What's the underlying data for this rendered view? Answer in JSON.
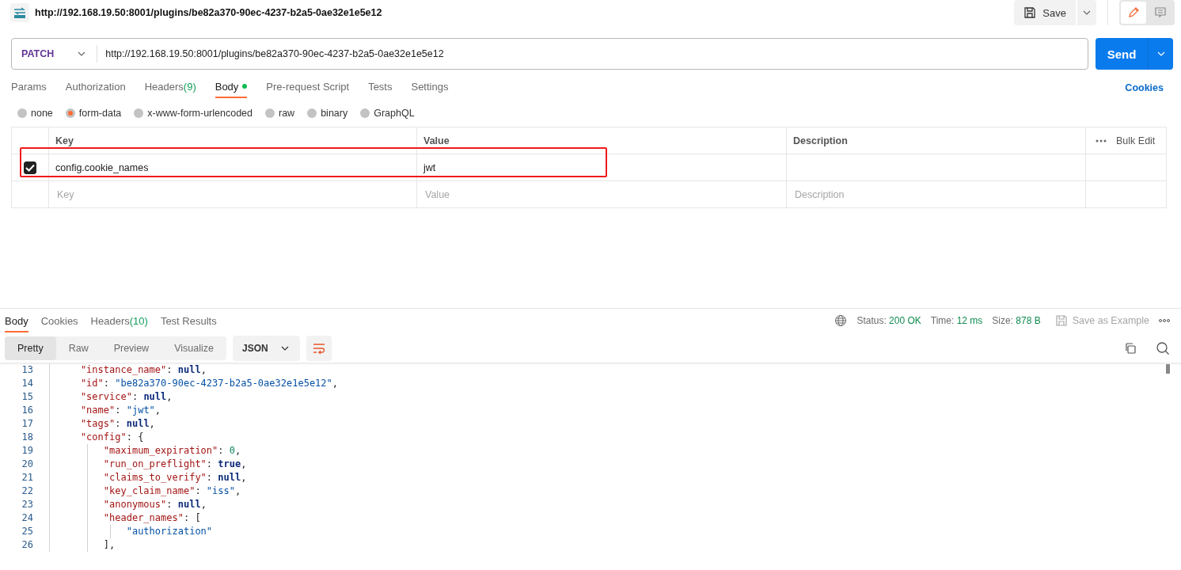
{
  "header": {
    "title": "http://192.168.19.50:8001/plugins/be82a370-90ec-4237-b2a5-0ae32e1e5e12",
    "save_label": "Save",
    "mode": [
      {
        "kind": "edit",
        "selected": true
      },
      {
        "kind": "comment",
        "selected": false
      }
    ]
  },
  "request": {
    "method": "PATCH",
    "url": "http://192.168.19.50:8001/plugins/be82a370-90ec-4237-b2a5-0ae32e1e5e12",
    "send_label": "Send"
  },
  "request_tabs": [
    {
      "label": "Params",
      "selected": false
    },
    {
      "label": "Authorization",
      "selected": false
    },
    {
      "label": "Headers",
      "count": "(9)",
      "selected": false
    },
    {
      "label": "Body",
      "dot": true,
      "selected": true
    },
    {
      "label": "Pre-request Script",
      "selected": false
    },
    {
      "label": "Tests",
      "selected": false
    },
    {
      "label": "Settings",
      "selected": false
    }
  ],
  "cookies_link": "Cookies",
  "body_types": [
    {
      "label": "none",
      "selected": false
    },
    {
      "label": "form-data",
      "selected": true
    },
    {
      "label": "x-www-form-urlencoded",
      "selected": false
    },
    {
      "label": "raw",
      "selected": false
    },
    {
      "label": "binary",
      "selected": false
    },
    {
      "label": "GraphQL",
      "selected": false
    }
  ],
  "form_table": {
    "columns": [
      "Key",
      "Value",
      "Description"
    ],
    "bulk_edit": "Bulk Edit",
    "rows": [
      {
        "checked": true,
        "highlighted": true,
        "key": "config.cookie_names",
        "value": "jwt"
      }
    ],
    "new_row": {
      "key_placeholder": "Key",
      "value_placeholder": "Value",
      "description_placeholder": "Description"
    }
  },
  "response_tabs": [
    {
      "label": "Body",
      "selected": true
    },
    {
      "label": "Cookies",
      "selected": false
    },
    {
      "label": "Headers",
      "count": "(10)",
      "selected": false
    },
    {
      "label": "Test Results",
      "selected": false
    }
  ],
  "response_meta": [
    {
      "label": "Status:",
      "value": "200 OK"
    },
    {
      "label": "Time:",
      "value": "12 ms"
    },
    {
      "label": "Size:",
      "value": "878 B"
    }
  ],
  "save_example": "Save as Example",
  "view_modes": [
    {
      "label": "Pretty",
      "selected": true
    },
    {
      "label": "Raw",
      "selected": false
    },
    {
      "label": "Preview",
      "selected": false
    },
    {
      "label": "Visualize",
      "selected": false
    }
  ],
  "format": "JSON",
  "code_lines": [
    {
      "number": "13",
      "tokens": [
        {
          "kind": "key",
          "text": "    \"instance_name\""
        },
        {
          "kind": "punct",
          "text": ": "
        },
        {
          "kind": "literal",
          "text": "null"
        },
        {
          "kind": "punct",
          "text": ","
        }
      ]
    },
    {
      "number": "14",
      "tokens": [
        {
          "kind": "key",
          "text": "    \"id\""
        },
        {
          "kind": "punct",
          "text": ": "
        },
        {
          "kind": "string",
          "text": "\"be82a370-90ec-4237-b2a5-0ae32e1e5e12\""
        },
        {
          "kind": "punct",
          "text": ","
        }
      ]
    },
    {
      "number": "15",
      "tokens": [
        {
          "kind": "key",
          "text": "    \"service\""
        },
        {
          "kind": "punct",
          "text": ": "
        },
        {
          "kind": "literal",
          "text": "null"
        },
        {
          "kind": "punct",
          "text": ","
        }
      ]
    },
    {
      "number": "16",
      "tokens": [
        {
          "kind": "key",
          "text": "    \"name\""
        },
        {
          "kind": "punct",
          "text": ": "
        },
        {
          "kind": "string",
          "text": "\"jwt\""
        },
        {
          "kind": "punct",
          "text": ","
        }
      ]
    },
    {
      "number": "17",
      "tokens": [
        {
          "kind": "key",
          "text": "    \"tags\""
        },
        {
          "kind": "punct",
          "text": ": "
        },
        {
          "kind": "literal",
          "text": "null"
        },
        {
          "kind": "punct",
          "text": ","
        }
      ]
    },
    {
      "number": "18",
      "tokens": [
        {
          "kind": "key",
          "text": "    \"config\""
        },
        {
          "kind": "punct",
          "text": ": {"
        }
      ]
    },
    {
      "number": "19",
      "tokens": [
        {
          "kind": "key",
          "text": "        \"maximum_expiration\""
        },
        {
          "kind": "punct",
          "text": ": "
        },
        {
          "kind": "number",
          "text": "0"
        },
        {
          "kind": "punct",
          "text": ","
        }
      ]
    },
    {
      "number": "20",
      "tokens": [
        {
          "kind": "key",
          "text": "        \"run_on_preflight\""
        },
        {
          "kind": "punct",
          "text": ": "
        },
        {
          "kind": "literal",
          "text": "true"
        },
        {
          "kind": "punct",
          "text": ","
        }
      ]
    },
    {
      "number": "21",
      "tokens": [
        {
          "kind": "key",
          "text": "        \"claims_to_verify\""
        },
        {
          "kind": "punct",
          "text": ": "
        },
        {
          "kind": "literal",
          "text": "null"
        },
        {
          "kind": "punct",
          "text": ","
        }
      ]
    },
    {
      "number": "22",
      "tokens": [
        {
          "kind": "key",
          "text": "        \"key_claim_name\""
        },
        {
          "kind": "punct",
          "text": ": "
        },
        {
          "kind": "string",
          "text": "\"iss\""
        },
        {
          "kind": "punct",
          "text": ","
        }
      ]
    },
    {
      "number": "23",
      "tokens": [
        {
          "kind": "key",
          "text": "        \"anonymous\""
        },
        {
          "kind": "punct",
          "text": ": "
        },
        {
          "kind": "literal",
          "text": "null"
        },
        {
          "kind": "punct",
          "text": ","
        }
      ]
    },
    {
      "number": "24",
      "tokens": [
        {
          "kind": "key",
          "text": "        \"header_names\""
        },
        {
          "kind": "punct",
          "text": ": ["
        }
      ]
    },
    {
      "number": "25",
      "tokens": [
        {
          "kind": "string",
          "text": "            \"authorization\""
        }
      ]
    },
    {
      "number": "26",
      "tokens": [
        {
          "kind": "punct",
          "text": "        ],"
        }
      ]
    }
  ]
}
